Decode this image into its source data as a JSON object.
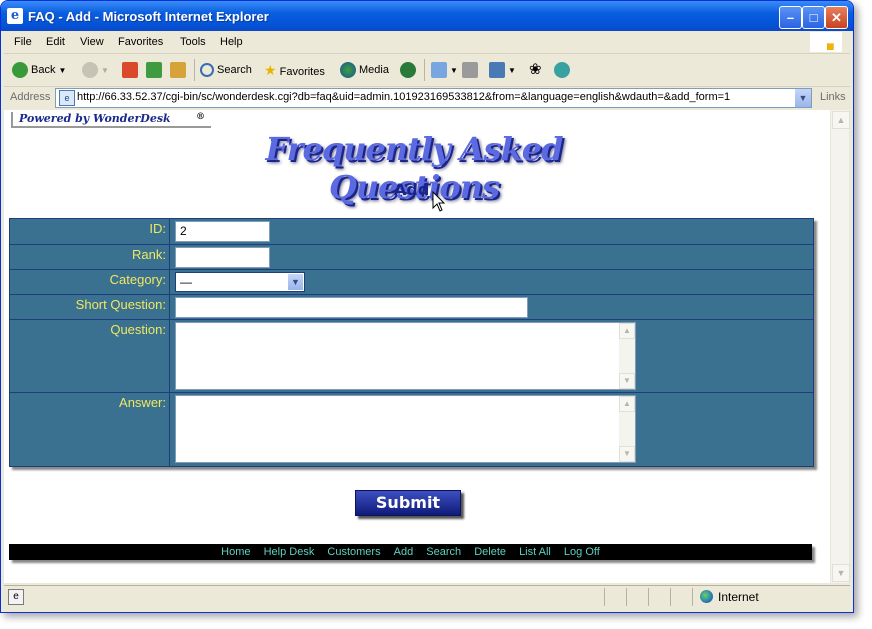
{
  "window": {
    "title": "FAQ - Add - Microsoft Internet Explorer",
    "controls": {
      "minimize": "–",
      "maximize": "□",
      "close": "✕"
    }
  },
  "menu": [
    "File",
    "Edit",
    "View",
    "Favorites",
    "Tools",
    "Help"
  ],
  "toolbar": {
    "back": "Back",
    "search": "Search",
    "favorites": "Favorites",
    "media": "Media"
  },
  "address": {
    "label": "Address",
    "url": "http://66.33.52.37/cgi-bin/sc/wonderdesk.cgi?db=faq&uid=admin.101923169533812&from=&language=english&wdauth=&add_form=1",
    "links": "Links"
  },
  "page": {
    "powered_by": "Powered by WonderDesk",
    "powered_mark": "®",
    "heading": "Frequently Asked Questions",
    "subheading": "Add",
    "form": {
      "id_label": "ID:",
      "id_value": "2",
      "rank_label": "Rank:",
      "rank_value": "",
      "category_label": "Category:",
      "category_value": "—",
      "short_question_label": "Short Question:",
      "short_question_value": "",
      "question_label": "Question:",
      "answer_label": "Answer:"
    },
    "submit_label": "Submit",
    "footer_links": [
      "Home",
      "Help Desk",
      "Customers",
      "Add",
      "Search",
      "Delete",
      "List All",
      "Log Off"
    ]
  },
  "status": {
    "zone": "Internet"
  }
}
